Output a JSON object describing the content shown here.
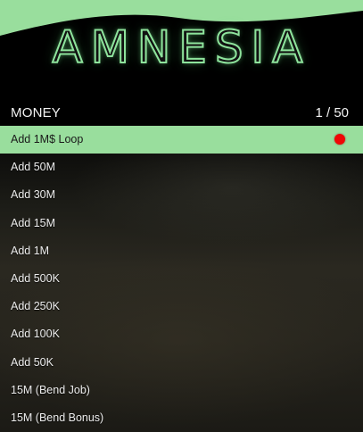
{
  "header": {
    "logo_text": "AMNESIA",
    "accent_color": "#99de9d"
  },
  "menu": {
    "section_title": "MONEY",
    "page_counter": "1 / 50",
    "selected_index": 0,
    "items": [
      {
        "label": "Add 1M$ Loop",
        "toggle_state": "off",
        "toggle_color": "#f00606"
      },
      {
        "label": "Add 50M"
      },
      {
        "label": "Add 30M"
      },
      {
        "label": "Add 15M"
      },
      {
        "label": "Add 1M"
      },
      {
        "label": "Add 500K"
      },
      {
        "label": "Add 250K"
      },
      {
        "label": "Add 100K"
      },
      {
        "label": "Add 50K"
      },
      {
        "label": "15M (Bend Job)"
      },
      {
        "label": "15M (Bend Bonus)"
      }
    ]
  }
}
